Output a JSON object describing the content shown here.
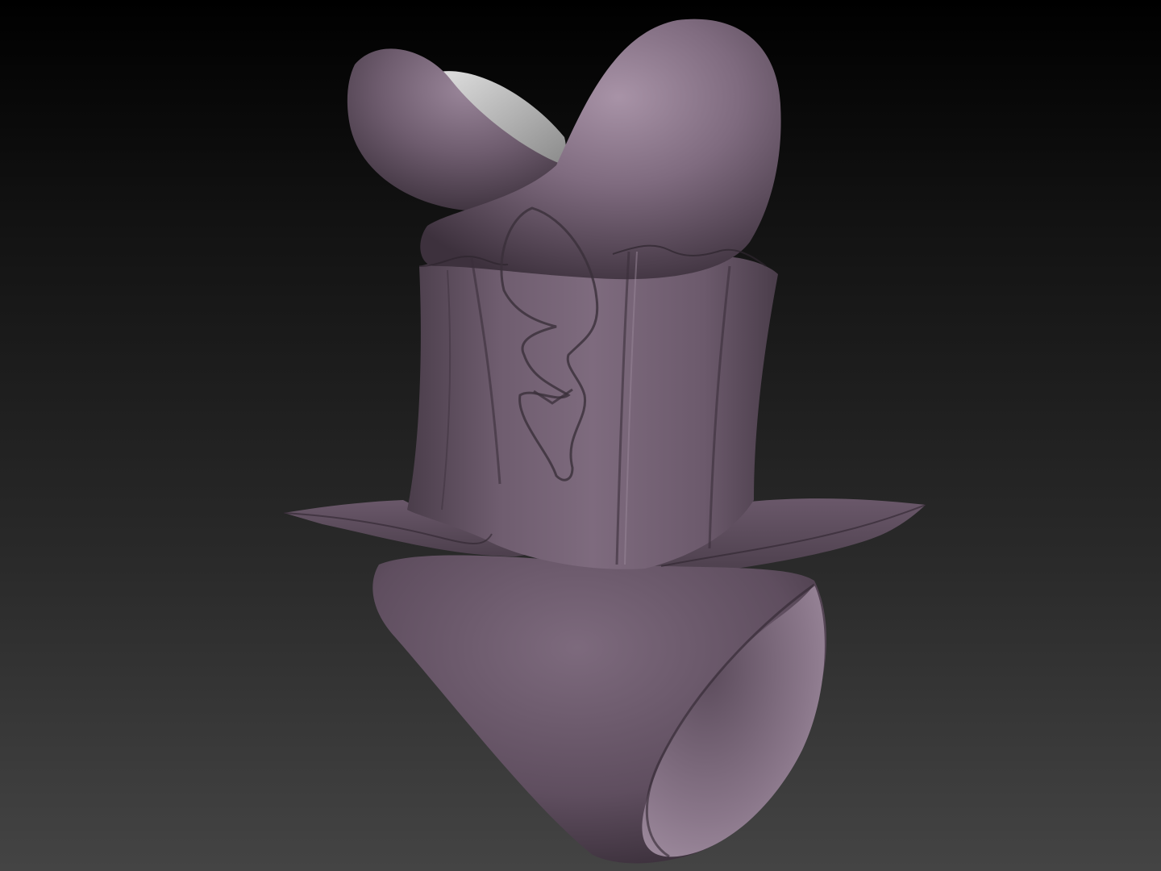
{
  "viewport": {
    "background_top": "#000000",
    "background_bottom": "#444444"
  },
  "model": {
    "subject": "corset-bodysuit-sculpt",
    "material_color": "#7d6a7d",
    "highlight_color": "#a893a7",
    "shadow_color": "#3a2f3a",
    "inner_color": "#b8b8b8"
  }
}
